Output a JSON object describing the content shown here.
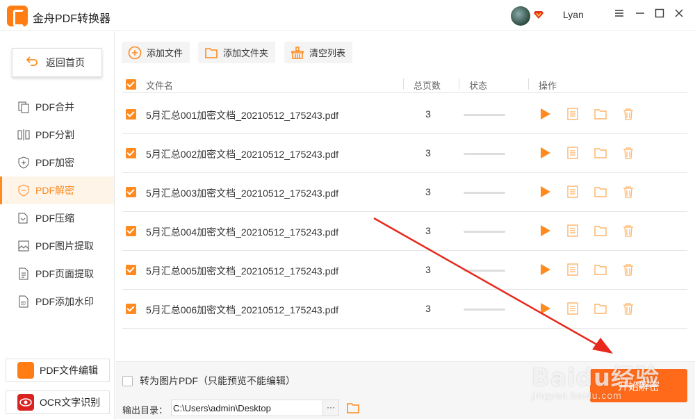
{
  "app": {
    "title": "金舟PDF转换器",
    "user": "Lyan",
    "accent": "#ff8a1f",
    "window_controls": [
      "menu-icon",
      "minimize-icon",
      "maximize-icon",
      "close-icon"
    ]
  },
  "sidebar": {
    "home_label": "返回首页",
    "items": [
      {
        "label": "PDF合并",
        "icon": "merge-icon",
        "active": false
      },
      {
        "label": "PDF分割",
        "icon": "split-icon",
        "active": false
      },
      {
        "label": "PDF加密",
        "icon": "shield-plus-icon",
        "active": false
      },
      {
        "label": "PDF解密",
        "icon": "shield-minus-icon",
        "active": true
      },
      {
        "label": "PDF压缩",
        "icon": "compress-icon",
        "active": false
      },
      {
        "label": "PDF图片提取",
        "icon": "image-icon",
        "active": false
      },
      {
        "label": "PDF页面提取",
        "icon": "page-icon",
        "active": false
      },
      {
        "label": "PDF添加水印",
        "icon": "watermark-icon",
        "active": false
      }
    ],
    "bottom_tools": [
      {
        "label": "PDF文件编辑",
        "icon": "pdf-edit-icon"
      },
      {
        "label": "OCR文字识别",
        "icon": "ocr-eye-icon"
      }
    ]
  },
  "toolbar": {
    "add_file": "添加文件",
    "add_folder": "添加文件夹",
    "clear_list": "清空列表"
  },
  "table": {
    "headers": {
      "name": "文件名",
      "pages": "总页数",
      "status": "状态",
      "actions": "操作"
    },
    "rows": [
      {
        "name": "5月汇总001加密文档_20210512_175243.pdf",
        "pages": "3"
      },
      {
        "name": "5月汇总002加密文档_20210512_175243.pdf",
        "pages": "3"
      },
      {
        "name": "5月汇总003加密文档_20210512_175243.pdf",
        "pages": "3"
      },
      {
        "name": "5月汇总004加密文档_20210512_175243.pdf",
        "pages": "3"
      },
      {
        "name": "5月汇总005加密文档_20210512_175243.pdf",
        "pages": "3"
      },
      {
        "name": "5月汇总006加密文档_20210512_175243.pdf",
        "pages": "3"
      }
    ],
    "row_actions": [
      "play-icon",
      "document-icon",
      "folder-icon",
      "trash-icon"
    ]
  },
  "footer": {
    "convert_image_option": "转为图片PDF（只能预览不能编辑）",
    "output_label": "输出目录：",
    "output_path": "C:\\Users\\admin\\Desktop",
    "browse": "···",
    "start_button": "开始解密"
  },
  "watermark": {
    "line1": "Baidu经验",
    "line2": "jingyan.baidu.com"
  }
}
